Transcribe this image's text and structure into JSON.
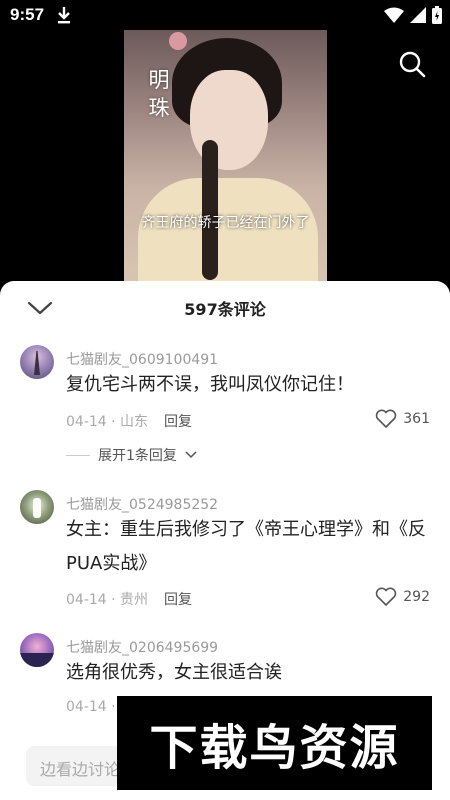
{
  "status_bar": {
    "time": "9:57",
    "icons": [
      "download-icon",
      "wifi-icon",
      "signal-icon",
      "battery-icon"
    ]
  },
  "video": {
    "title_text": "明珠",
    "subtitle": "齐王府的轿子已经在门外了"
  },
  "comments_panel": {
    "title": "597条评论",
    "comments": [
      {
        "username": "七猫剧友_0609100491",
        "text": "复仇宅斗两不误，我叫凤仪你记住！",
        "date_location": "04-14 · 山东",
        "reply_label": "回复",
        "likes": "361",
        "expand_label": "展开1条回复"
      },
      {
        "username": "七猫剧友_0524985252",
        "text": "女主：重生后我修习了《帝王心理学》和《反PUA实战》",
        "date_location": "04-14 · 贵州",
        "reply_label": "回复",
        "likes": "292"
      },
      {
        "username": "七猫剧友_0206495699",
        "text": "选角很优秀，女主很适合诶",
        "date_location": "04-14 ·"
      }
    ]
  },
  "input": {
    "placeholder": "边看边讨论"
  },
  "watermark": {
    "text": "下载鸟资源"
  },
  "colors": {
    "background": "#000000",
    "sheet": "#ffffff",
    "username": "#9a9a9a",
    "text": "#222222"
  }
}
